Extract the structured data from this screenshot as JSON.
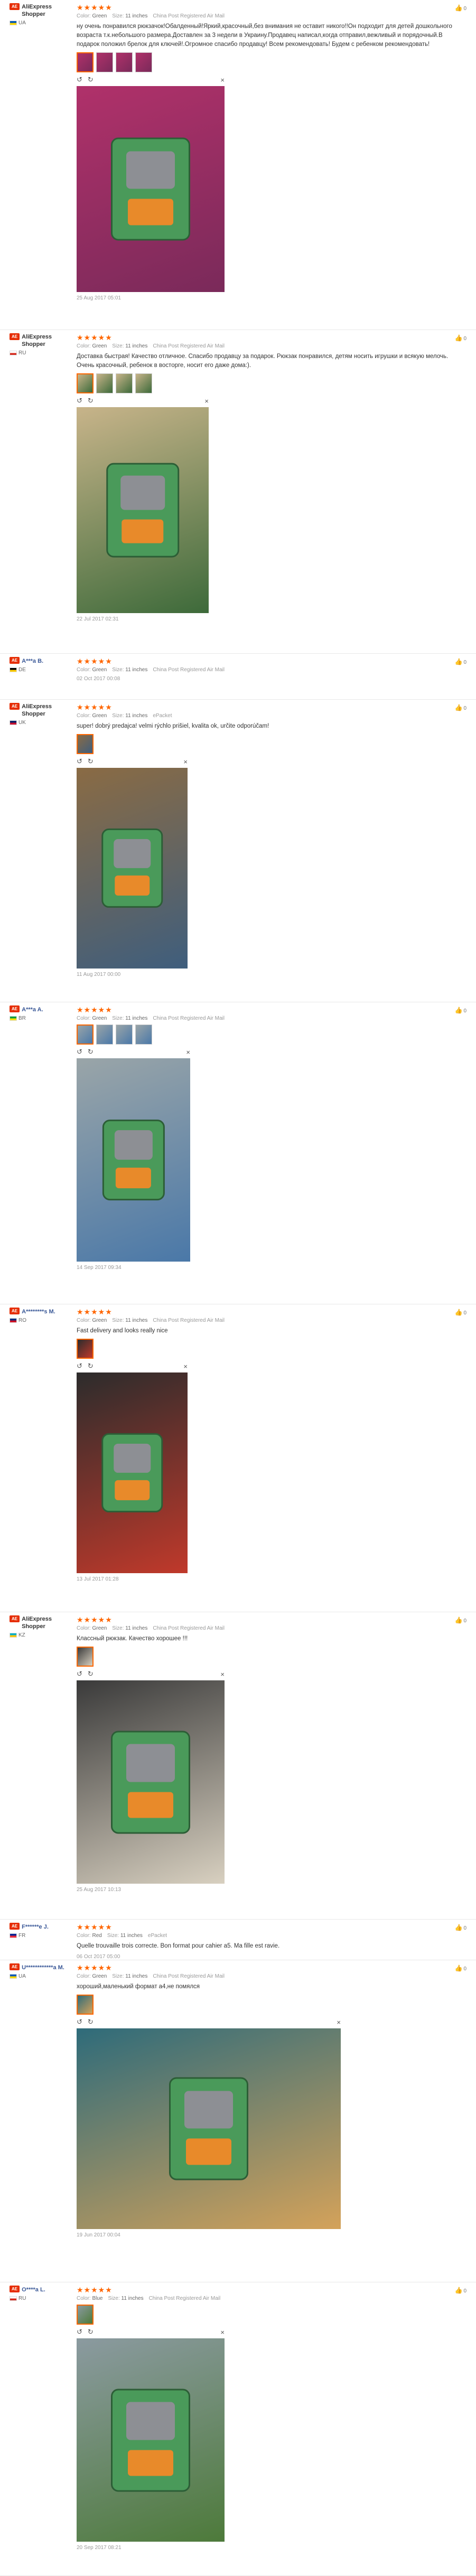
{
  "labels": {
    "color": "Color:",
    "size": "Size:"
  },
  "icons": {
    "helpful": "thumbs-up-icon",
    "rotate_left": "rotate-left-icon",
    "rotate_right": "rotate-right-icon",
    "close": "close-icon",
    "badge": "aliexpress-badge"
  },
  "colors": {
    "star": "#ff6600",
    "badge": "#e62e04",
    "link": "#3b5998"
  },
  "reviews": [
    {
      "user": "AliExpress Shopper",
      "country": "UA",
      "stars": "★★★★★",
      "color_value": "Green",
      "size_value": "11 inches",
      "shipping": "China Post Registered Air Mail",
      "text": "ну очень понравился рюкзачок!Обалденный!Яркий,красочный,без внимания не оставит никого!!Он подходит для детей дошкольного возраста т.к.небольшого размера.Доставлен за 3 недели в Украину.Продавец написал,когда отправил,вежливый и порядочный.В подарок положил брелок для ключей!.Огромное спасибо продавцу! Всем рекомендовать! Будем с ребенком рекомендовать!",
      "helpful": "0",
      "date": "25 Aug 2017 05:01"
    },
    {
      "user": "AliExpress Shopper",
      "country": "RU",
      "stars": "★★★★★",
      "color_value": "Green",
      "size_value": "11 inches",
      "shipping": "China Post Registered Air Mail",
      "text": "Доставка быстрая! Качество отличное. Спасибо продавцу за подарок. Рюкзак понравился, детям носить игрушки и всякую мелочь. Очень красочный, ребенок в восторге, носит его даже дома:).",
      "helpful": "0",
      "date": "22 Jul 2017 02:31"
    },
    {
      "user": "A***a B.",
      "country": "DE",
      "stars": "★★★★★",
      "color_value": "Green",
      "size_value": "11 inches",
      "shipping": "China Post Registered Air Mail",
      "text": "",
      "helpful": "0",
      "date": "02 Oct 2017 00:08"
    },
    {
      "user": "AliExpress Shopper",
      "country": "UK",
      "stars": "★★★★★",
      "color_value": "Green",
      "size_value": "11 inches",
      "shipping": "ePacket",
      "text": "super! dobrý predajca! velmi rýchlo prišiel, kvalita ok, určite odporúčam!",
      "helpful": "0",
      "date": "11 Aug 2017 00:00"
    },
    {
      "user": "A***a A.",
      "country": "BR",
      "stars": "★★★★★",
      "color_value": "Green",
      "size_value": "11 inches",
      "shipping": "China Post Registered Air Mail",
      "text": "",
      "helpful": "0",
      "date": "14 Sep 2017 09:34"
    },
    {
      "user": "A********s M.",
      "country": "RO",
      "stars": "★★★★★",
      "color_value": "Green",
      "size_value": "11 inches",
      "shipping": "China Post Registered Air Mail",
      "text": "Fast delivery and looks really nice",
      "helpful": "0",
      "date": "13 Jul 2017 01:28"
    },
    {
      "user": "AliExpress Shopper",
      "country": "KZ",
      "stars": "★★★★★",
      "color_value": "Green",
      "size_value": "11 inches",
      "shipping": "China Post Registered Air Mail",
      "text": "Классный рюкзак. Качество хорошее !!!",
      "helpful": "0",
      "date": "25 Aug 2017 10:13"
    },
    {
      "user": "F******e J.",
      "country": "FR",
      "stars": "★★★★★",
      "color_value": "Red",
      "size_value": "11 inches",
      "shipping": "ePacket",
      "text": "Quelle trouvaille trois correcte. Bon format pour cahier a5. Ma fille est ravie.",
      "helpful": "0",
      "date": "06 Oct 2017 05:00"
    },
    {
      "user": "U************a M.",
      "country": "UA",
      "stars": "★★★★★",
      "color_value": "Green",
      "size_value": "11 inches",
      "shipping": "China Post Registered Air Mail",
      "text": "хороший,маленький формат а4,не помялся",
      "helpful": "0",
      "date": "19 Jun 2017 00:04"
    },
    {
      "user": "O****a L.",
      "country": "RU",
      "stars": "★★★★★",
      "color_value": "Blue",
      "size_value": "11 inches",
      "shipping": "China Post Registered Air Mail",
      "text": "",
      "helpful": "0",
      "date": "20 Sep 2017 08:21"
    }
  ]
}
